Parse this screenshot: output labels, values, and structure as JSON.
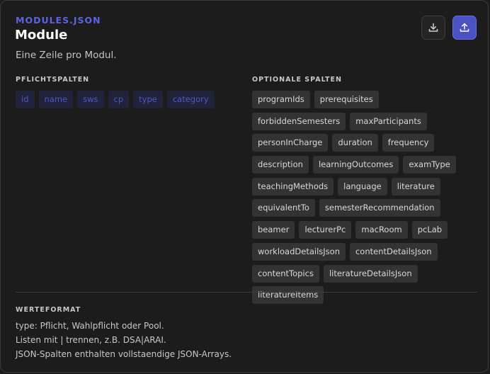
{
  "card": {
    "filename": "MODULES.JSON",
    "title": "Module",
    "description": "Eine Zeile pro Modul."
  },
  "actions": {
    "download_icon": "download-icon",
    "upload_icon": "upload-icon",
    "upload_accent": "#4a52c6"
  },
  "required": {
    "label": "PFLICHTSPALTEN",
    "columns": [
      "id",
      "name",
      "sws",
      "cp",
      "type",
      "category"
    ]
  },
  "optional": {
    "label": "OPTIONALE SPALTEN",
    "columns": [
      "programIds",
      "prerequisites",
      "forbiddenSemesters",
      "maxParticipants",
      "personInCharge",
      "duration",
      "frequency",
      "description",
      "learningOutcomes",
      "examType",
      "teachingMethods",
      "language",
      "literature",
      "equivalentTo",
      "semesterRecommendation",
      "beamer",
      "lecturerPc",
      "macRoom",
      "pcLab",
      "workloadDetailsJson",
      "contentDetailsJson",
      "contentTopics",
      "literatureDetailsJson",
      "literatureItems"
    ]
  },
  "format": {
    "label": "WERTEFORMAT",
    "lines": [
      "type: Pflicht, Wahlpflicht oder Pool.",
      "Listen mit | trennen, z.B. DSA|ARAI.",
      "JSON-Spalten enthalten vollstaendige JSON-Arrays."
    ]
  }
}
